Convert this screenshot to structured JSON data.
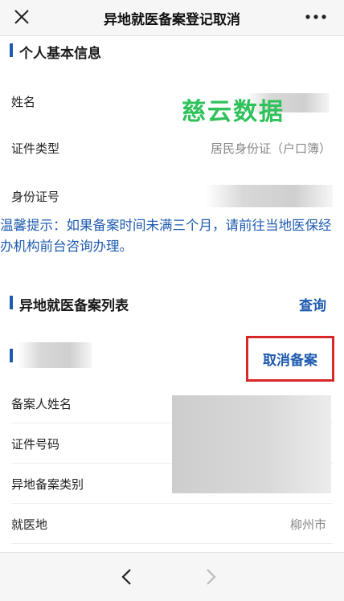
{
  "header": {
    "title": "异地就医备案登记取消",
    "close_icon": "close-icon",
    "more_icon": "more-icon"
  },
  "personal_info": {
    "section_label": "个人基本信息",
    "fields": [
      {
        "label": "姓名",
        "value": ""
      },
      {
        "label": "证件类型",
        "value": "居民身份证（户口簿）"
      },
      {
        "label": "身份证号",
        "value": ""
      }
    ]
  },
  "watermark": "慈云数据",
  "tip": "温馨提示：如果备案时间未满三个月，请前往当地医保经办机构前台咨询办理。",
  "record_list": {
    "section_label": "异地就医备案列表",
    "action_label": "查询"
  },
  "record": {
    "cancel_label": "取消备案",
    "fields": [
      {
        "label": "备案人姓名",
        "value": ""
      },
      {
        "label": "证件号码",
        "value": ""
      },
      {
        "label": "异地备案类别",
        "value": ""
      },
      {
        "label": "就医地",
        "value": "柳州市"
      }
    ]
  },
  "colors": {
    "accent": "#1e5bb0",
    "highlight_border": "#d82727",
    "watermark": "#2fc25b"
  }
}
